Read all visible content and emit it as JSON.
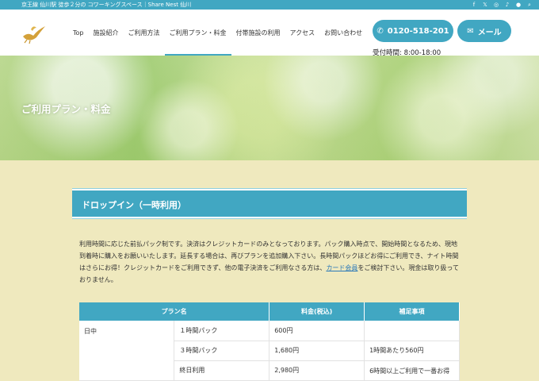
{
  "topbar": {
    "tagline": "京王線 仙川駅 徒歩２分の コワーキングスペース｜Share Nest 仙川",
    "social": [
      {
        "icon": "facebook-icon",
        "glyph": "f"
      },
      {
        "icon": "x-icon",
        "glyph": "𝕏"
      },
      {
        "icon": "instagram-icon",
        "glyph": "◎"
      },
      {
        "icon": "tiktok-icon",
        "glyph": "♪"
      },
      {
        "icon": "line-icon",
        "glyph": "●"
      },
      {
        "icon": "search-icon",
        "glyph": "⌕"
      }
    ]
  },
  "nav": {
    "items": [
      {
        "label": "Top"
      },
      {
        "label": "施設紹介"
      },
      {
        "label": "ご利用方法"
      },
      {
        "label": "ご利用プラン・料金",
        "active": true
      },
      {
        "label": "付帯施設の利用"
      },
      {
        "label": "アクセス"
      },
      {
        "label": "お問い合わせ"
      }
    ],
    "phone": "0120-518-201",
    "mail": "メール",
    "hours": "受付時間: 8:00-18:00"
  },
  "hero": {
    "title": "ご利用プラン・料金"
  },
  "section": {
    "title": "ドロップイン（一時利用）",
    "desc_before": "利用時間に応じた前払パック制です。決済はクレジットカードのみとなっております。パック購入時点で、開始時間となるため、現地到着時に購入をお願いいたします。延長する場合は、再びプランを追加購入下さい。長時間パックほどお得にご利用でき、ナイト時間はさらにお得！クレジットカードをご利用できず、他の電子決済をご利用なさる方は、",
    "desc_link": "カード会員",
    "desc_after": "をご検討下さい。現金は取り扱っておりません。"
  },
  "table": {
    "headers": [
      "プラン名",
      "料金(税込)",
      "補足事項"
    ],
    "period": "日中",
    "rows": [
      {
        "plan": "１時間パック",
        "price": "600円",
        "note": ""
      },
      {
        "plan": "３時間パック",
        "price": "1,680円",
        "note": "1時間あたり560円"
      },
      {
        "plan": "終日利用",
        "price": "2,980円",
        "note": "6時間以上ご利用で一番お得"
      }
    ]
  }
}
